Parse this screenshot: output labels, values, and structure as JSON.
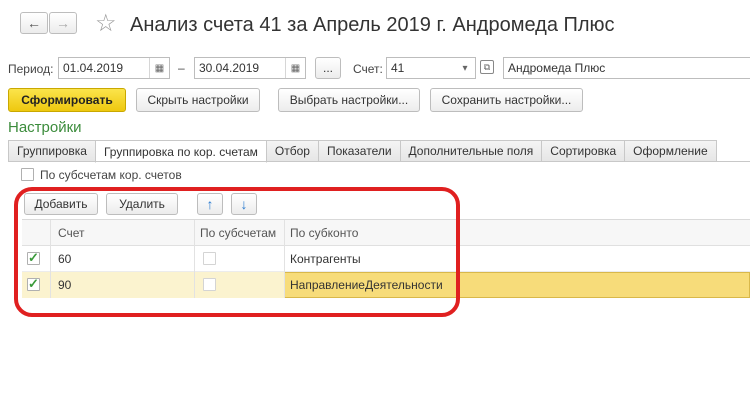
{
  "window": {
    "title": "Анализ счета 41 за Апрель 2019 г. Андромеда Плюс",
    "back_icon": "←",
    "forward_icon": "→",
    "star_icon": "☆"
  },
  "filters": {
    "period_label": "Период:",
    "period_from": "01.04.2019",
    "period_dash": "–",
    "period_to": "30.04.2019",
    "period_dots": "...",
    "account_label": "Счет:",
    "account_value": "41",
    "org_value": "Андромеда Плюс"
  },
  "toolbar": {
    "generate": "Сформировать",
    "hide_settings": "Скрыть настройки",
    "choose_settings": "Выбрать настройки...",
    "save_settings": "Сохранить настройки..."
  },
  "settings_heading": "Настройки",
  "tabs": [
    {
      "label": "Группировка",
      "active": false
    },
    {
      "label": "Группировка по кор. счетам",
      "active": true
    },
    {
      "label": "Отбор",
      "active": false
    },
    {
      "label": "Показатели",
      "active": false
    },
    {
      "label": "Дополнительные поля",
      "active": false
    },
    {
      "label": "Сортировка",
      "active": false
    },
    {
      "label": "Оформление",
      "active": false
    }
  ],
  "subaccounts_option": {
    "label": "По субсчетам кор. счетов",
    "checked": false
  },
  "grid_toolbar": {
    "add": "Добавить",
    "delete": "Удалить",
    "up_icon": "↑",
    "down_icon": "↓"
  },
  "grid": {
    "columns": [
      "Счет",
      "По субсчетам",
      "По субконто"
    ],
    "rows": [
      {
        "enabled": true,
        "account": "60",
        "by_subaccounts": false,
        "by_subconto": "Контрагенты",
        "selected": false
      },
      {
        "enabled": true,
        "account": "90",
        "by_subaccounts": false,
        "by_subconto": "НаправлениеДеятельности",
        "selected": true
      }
    ]
  },
  "colors": {
    "accent_yellow": "#f5d321",
    "settings_green": "#3c8c3c",
    "highlight_red": "#e02020",
    "selected_row": "#fbf3cf"
  }
}
